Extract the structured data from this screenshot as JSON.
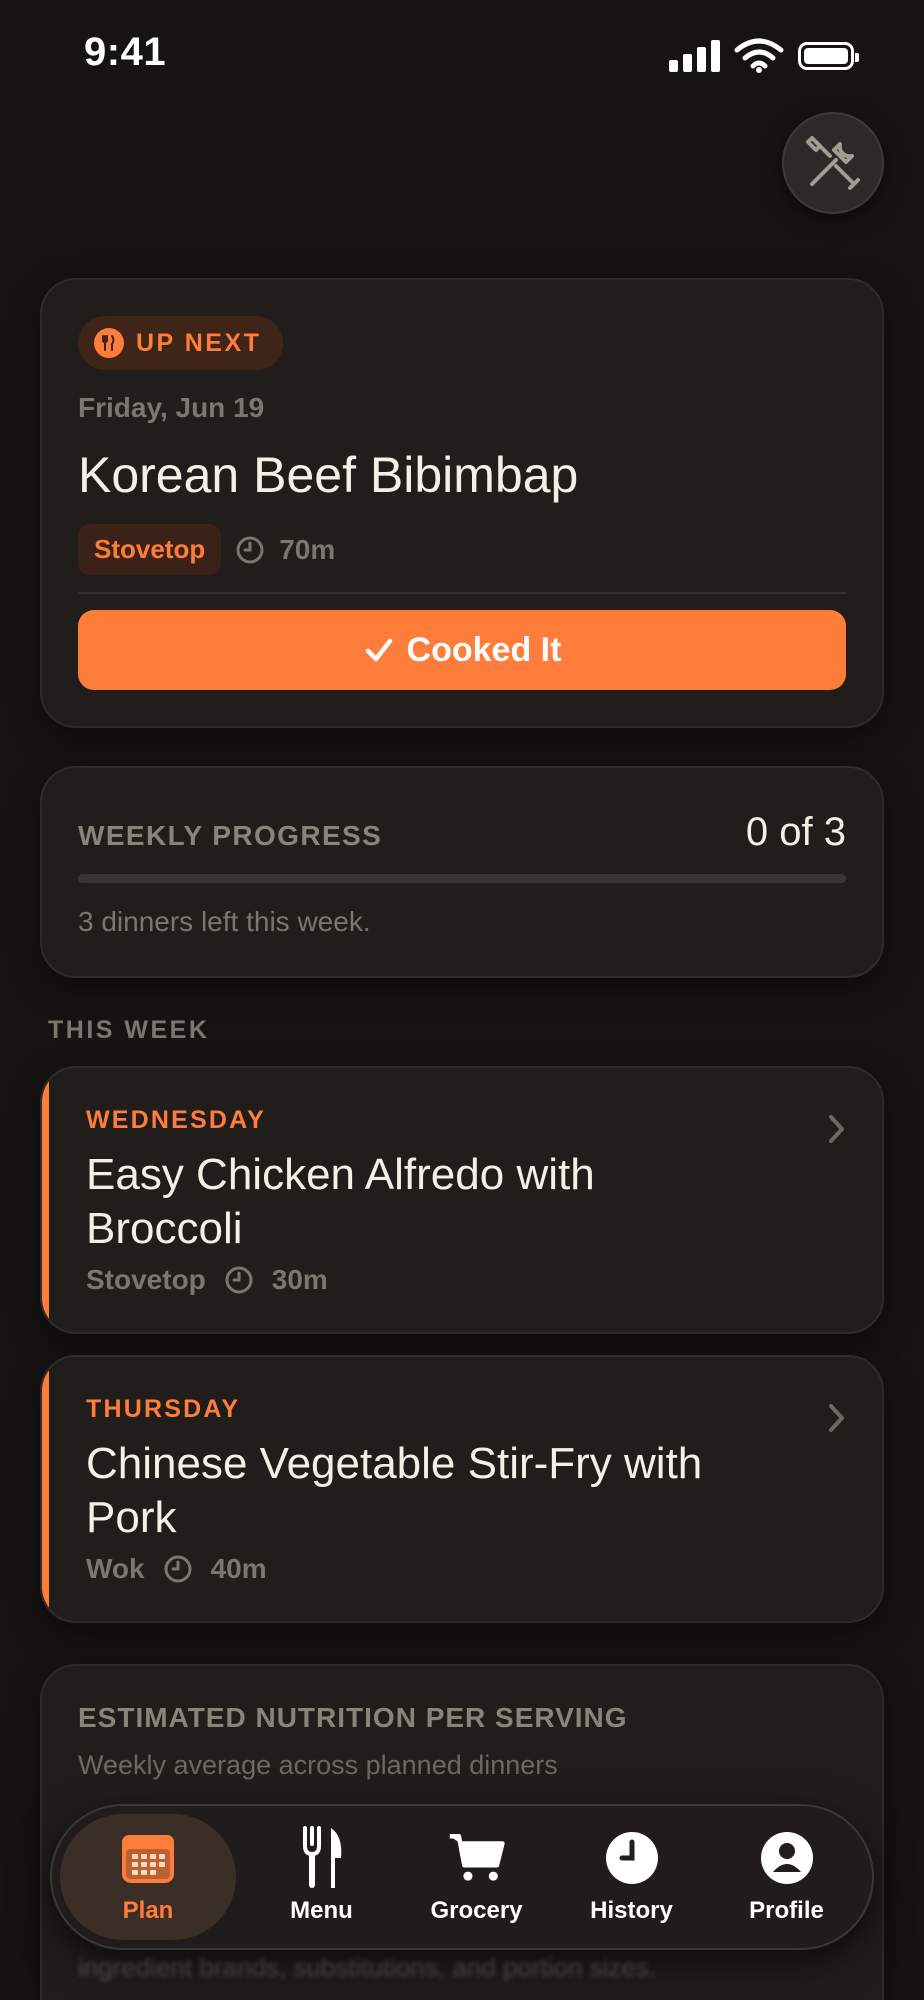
{
  "status_bar": {
    "time": "9:41"
  },
  "up_next": {
    "badge": "UP NEXT",
    "date": "Friday, Jun 19",
    "title": "Korean Beef Bibimbap",
    "method": "Stovetop",
    "time": "70m",
    "cta": "Cooked It"
  },
  "progress": {
    "label": "WEEKLY PROGRESS",
    "count": "0 of 3",
    "fraction": 0,
    "note": "3 dinners left this week."
  },
  "this_week": {
    "title": "THIS WEEK",
    "days": [
      {
        "day": "WEDNESDAY",
        "title": "Easy Chicken Alfredo with Broccoli",
        "method": "Stovetop",
        "time": "30m"
      },
      {
        "day": "THURSDAY",
        "title": "Chinese Vegetable Stir-Fry with Pork",
        "method": "Wok",
        "time": "40m"
      }
    ]
  },
  "nutrition": {
    "title": "ESTIMATED NUTRITION PER SERVING",
    "subtitle": "Weekly average across planned dinners",
    "disclaimer": "ingredient brands, substitutions, and portion sizes."
  },
  "tabs": [
    {
      "label": "Plan",
      "icon": "calendar-icon"
    },
    {
      "label": "Menu",
      "icon": "fork-knife-icon"
    },
    {
      "label": "Grocery",
      "icon": "cart-icon"
    },
    {
      "label": "History",
      "icon": "clock-icon"
    },
    {
      "label": "Profile",
      "icon": "person-icon"
    }
  ],
  "colors": {
    "accent": "#ff7d3b",
    "background": "#161412",
    "card": "#201d1b"
  }
}
